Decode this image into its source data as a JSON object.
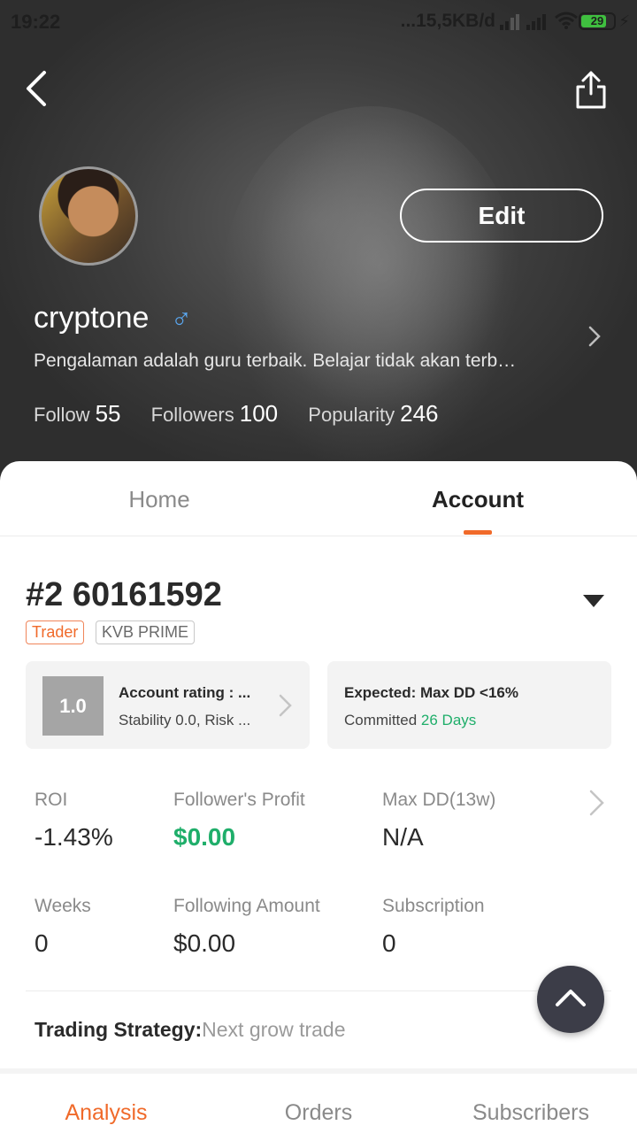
{
  "status_bar": {
    "time": "19:22",
    "network": "...15,5KB/d",
    "battery": "29"
  },
  "profile": {
    "username": "cryptone",
    "gender_symbol": "♂",
    "bio": "Pengalaman adalah guru terbaik. Belajar tidak akan terb…",
    "edit_label": "Edit",
    "stats": [
      {
        "label": "Follow",
        "value": "55"
      },
      {
        "label": "Followers",
        "value": "100"
      },
      {
        "label": "Popularity",
        "value": "246"
      }
    ]
  },
  "tabs": {
    "home": "Home",
    "account": "Account",
    "active": "Account"
  },
  "account": {
    "title": "#2 60161592",
    "tags": [
      "Trader",
      "KVB PRIME"
    ],
    "rating": {
      "score": "1.0",
      "title": "Account rating : ...",
      "subtitle": "Stability 0.0, Risk ..."
    },
    "expected": {
      "title": "Expected: Max DD <16%",
      "committed_label": "Committed",
      "committed_value": "26 Days"
    },
    "metrics": [
      {
        "label": "ROI",
        "value": "-1.43%"
      },
      {
        "label": "Follower's Profit",
        "value": "$0.00"
      },
      {
        "label": "Max DD(13w)",
        "value": "N/A"
      },
      {
        "label": "Weeks",
        "value": "0"
      },
      {
        "label": "Following Amount",
        "value": "$0.00"
      },
      {
        "label": "Subscription",
        "value": "0"
      }
    ],
    "strategy_label": "Trading Strategy:",
    "strategy_value": "Next grow trade"
  },
  "bottom_tabs": {
    "analysis": "Analysis",
    "orders": "Orders",
    "subscribers": "Subscribers",
    "active": "Analysis"
  },
  "colors": {
    "accent": "#f06a2a",
    "positive": "#1fae6a",
    "gender": "#5aa7f0",
    "fab": "#3c3d48"
  },
  "icons": [
    "back-arrow-icon",
    "share-icon",
    "chevron-right-icon",
    "dropdown-triangle-icon",
    "scroll-top-icon",
    "wifi-icon",
    "signal-icon",
    "battery-icon",
    "charging-bolt-icon"
  ]
}
